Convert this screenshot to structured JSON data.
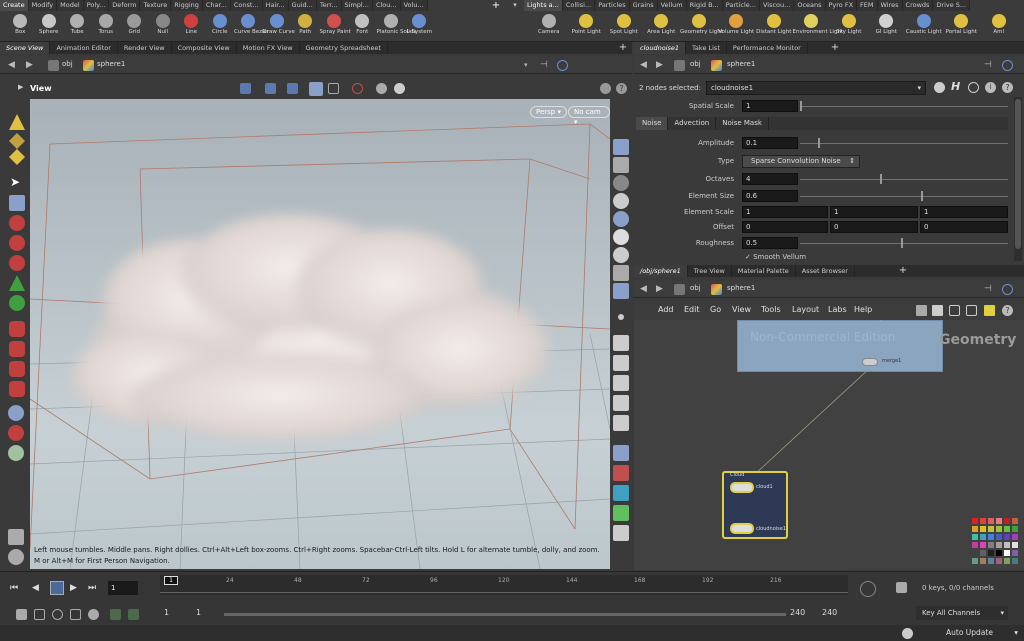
{
  "shelf": {
    "tabs_left": [
      "Create",
      "Modify",
      "Model",
      "Poly...",
      "Deform",
      "Texture",
      "Rigging",
      "Char...",
      "Const...",
      "Hair...",
      "Guid...",
      "Terr...",
      "Simpl...",
      "Clou...",
      "Volu..."
    ],
    "tabs_right": [
      "Lights a...",
      "Collisi...",
      "Particles",
      "Grains",
      "Vellum",
      "Rigid B...",
      "Particle...",
      "Viscou...",
      "Oceans",
      "Pyro FX",
      "FEM",
      "Wires",
      "Crowds",
      "Drive S..."
    ],
    "tools_left": [
      {
        "label": "Box",
        "color": "#b8b8b8",
        "icon": "box-icon"
      },
      {
        "label": "Sphere",
        "color": "#c8c8c8",
        "icon": "sphere-icon"
      },
      {
        "label": "Tube",
        "color": "#b0b0b0",
        "icon": "tube-icon"
      },
      {
        "label": "Torus",
        "color": "#a8a8a8",
        "icon": "torus-icon"
      },
      {
        "label": "Grid",
        "color": "#9a9a9a",
        "icon": "grid-icon"
      },
      {
        "label": "Null",
        "color": "#888",
        "icon": "null-icon"
      },
      {
        "label": "Line",
        "color": "#d04040",
        "icon": "line-icon"
      },
      {
        "label": "Circle",
        "color": "#6a8fd0",
        "icon": "circle-icon"
      },
      {
        "label": "Curve Bezier",
        "color": "#6a8fd0",
        "icon": "curve-bezier-icon"
      },
      {
        "label": "Draw Curve",
        "color": "#6a8fd0",
        "icon": "draw-curve-icon"
      },
      {
        "label": "Path",
        "color": "#d0b040",
        "icon": "path-icon"
      },
      {
        "label": "Spray Paint",
        "color": "#d05050",
        "icon": "spray-paint-icon"
      },
      {
        "label": "Font",
        "color": "#c0c0c0",
        "icon": "font-icon"
      },
      {
        "label": "Platonic Solids",
        "color": "#b0b0b0",
        "icon": "platonic-solids-icon"
      },
      {
        "label": "L-System",
        "color": "#6a8fd0",
        "icon": "l-system-icon"
      }
    ],
    "tools_right": [
      {
        "label": "Camera",
        "color": "#b0b0b0",
        "icon": "camera-icon"
      },
      {
        "label": "Point Light",
        "color": "#e0c040",
        "icon": "point-light-icon"
      },
      {
        "label": "Spot Light",
        "color": "#e0c040",
        "icon": "spot-light-icon"
      },
      {
        "label": "Area Light",
        "color": "#e0c040",
        "icon": "area-light-icon"
      },
      {
        "label": "Geometry Light",
        "color": "#e0c040",
        "icon": "geometry-light-icon"
      },
      {
        "label": "Volume Light",
        "color": "#e0a040",
        "icon": "volume-light-icon"
      },
      {
        "label": "Distant Light",
        "color": "#e0c040",
        "icon": "distant-light-icon"
      },
      {
        "label": "Environment Light",
        "color": "#e0d060",
        "icon": "environment-light-icon"
      },
      {
        "label": "Sky Light",
        "color": "#e0c040",
        "icon": "sky-light-icon"
      },
      {
        "label": "GI Light",
        "color": "#d0d0d0",
        "icon": "gi-light-icon"
      },
      {
        "label": "Caustic Light",
        "color": "#6a8fd0",
        "icon": "caustic-light-icon"
      },
      {
        "label": "Portal Light",
        "color": "#e0c040",
        "icon": "portal-light-icon"
      },
      {
        "label": "Aml",
        "color": "#e0c040",
        "icon": "ambient-light-icon"
      }
    ]
  },
  "left_pane": {
    "tabs": [
      "Scene View",
      "Animation Editor",
      "Render View",
      "Composite View",
      "Motion FX View",
      "Geometry Spreadsheet"
    ],
    "path_root": "obj",
    "path_node": "sphere1",
    "view_label": "View",
    "persp": "Persp",
    "cam": "No cam",
    "help_text_1": "Left mouse tumbles. Middle pans. Right dollies. Ctrl+Alt+Left box-zooms. Ctrl+Right zooms. Spacebar-Ctrl-Left tilts. Hold L for alternate tumble, dolly, and zoom.",
    "help_text_2": "M or Alt+M for First Person Navigation."
  },
  "param_pane": {
    "tabs": [
      "cloudnoise1",
      "Take List",
      "Performance Monitor"
    ],
    "path_root": "obj",
    "path_node": "sphere1",
    "nodes_selected": "2 nodes selected:",
    "node_name": "cloudnoise1",
    "spatial_scale_label": "Spatial Scale",
    "spatial_scale": "1",
    "subtabs": [
      "Noise",
      "Advection",
      "Noise Mask"
    ],
    "amplitude_label": "Amplitude",
    "amplitude": "0.1",
    "type_label": "Type",
    "type_value": "Sparse Convolution Noise",
    "octaves_label": "Octaves",
    "octaves": "4",
    "element_size_label": "Element Size",
    "element_size": "0.6",
    "element_scale_label": "Element Scale",
    "element_scale": [
      "1",
      "1",
      "1"
    ],
    "offset_label": "Offset",
    "offset": [
      "0",
      "0",
      "0"
    ],
    "roughness_label": "Roughness",
    "roughness": "0.5",
    "cut_off": "Smooth Vellum"
  },
  "network_pane": {
    "tabs": [
      "/obj/sphere1",
      "Tree View",
      "Material Palette",
      "Asset Browser"
    ],
    "path_root": "obj",
    "path_node": "sphere1",
    "menu": [
      "Add",
      "Edit",
      "Go",
      "View",
      "Tools",
      "Layout",
      "Labs",
      "Help"
    ],
    "watermark_1": "Non-Commercial Edition",
    "watermark_2": "Geometry",
    "merge_node": "merge1",
    "cloud_box": "Cloud",
    "cloud_node": "cloud1",
    "cloudnoise_node": "cloudnoise1"
  },
  "timeline": {
    "frame": "1",
    "ticks": [
      "24",
      "48",
      "72",
      "96",
      "120",
      "144",
      "168",
      "192",
      "216"
    ],
    "range_start": "1",
    "range_start2": "1",
    "range_end": "240",
    "range_end2": "240",
    "keys": "0 keys, 0/0 channels",
    "key_all": "Key All Channels",
    "auto_update": "Auto Update"
  },
  "swatches": [
    "#e02020",
    "#e04040",
    "#e06060",
    "#e08080",
    "#c02020",
    "#c06040",
    "#e0a020",
    "#e0c020",
    "#c0c040",
    "#a0c040",
    "#60c040",
    "#40a040",
    "#40c0a0",
    "#40a0c0",
    "#4080e0",
    "#4060c0",
    "#6040c0",
    "#a040c0",
    "#c040a0",
    "#e040c0",
    "#808080",
    "#a0a0a0",
    "#c0c0c0",
    "#e0e0e0",
    "#404040",
    "#606060",
    "#202020",
    "#000000",
    "#ffffff",
    "#8060a0",
    "#60a080",
    "#a08060",
    "#6080a0",
    "#a06080",
    "#80a060",
    "#408080"
  ]
}
